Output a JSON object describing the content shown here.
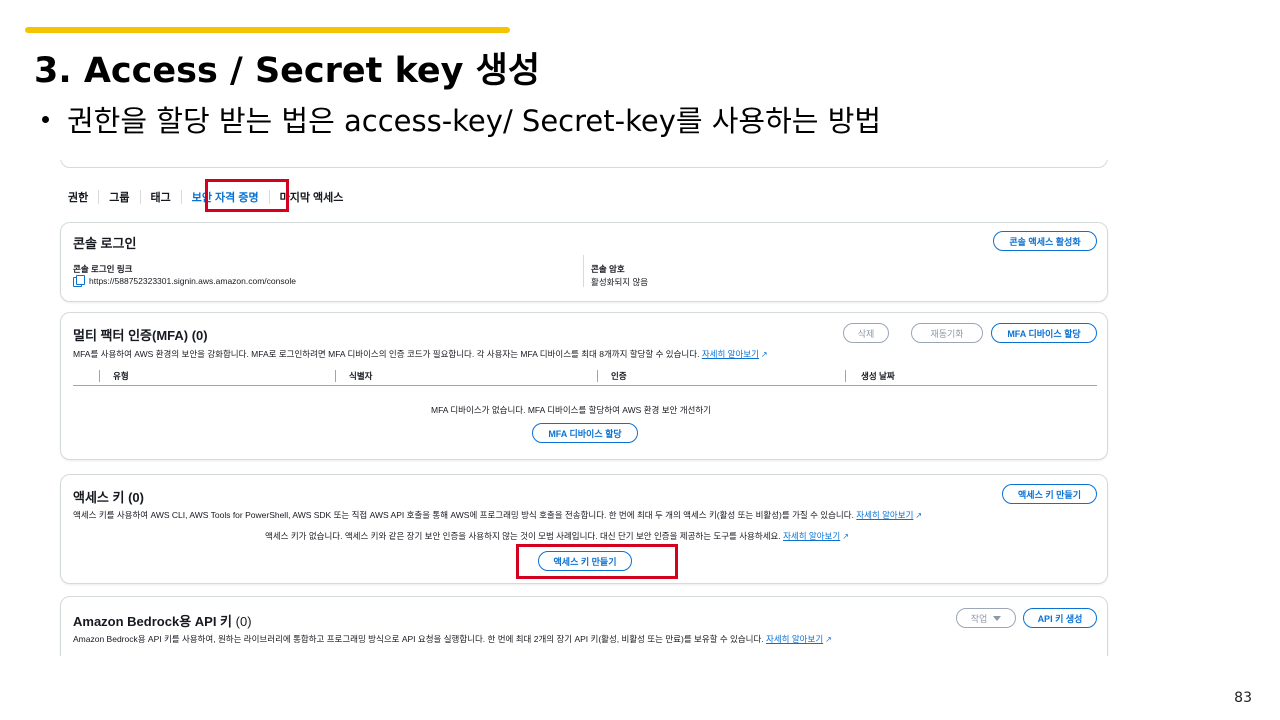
{
  "slide": {
    "title": "3. Access / Secret key 생성",
    "bullet": "권한을 할당 받는 법은 access-key/ Secret-key를 사용하는 방법",
    "page_number": "83"
  },
  "tabs": [
    "권한",
    "그룹",
    "태그",
    "보안 자격 증명",
    "마지막 액세스"
  ],
  "active_tab": "보안 자격 증명",
  "console_login": {
    "title": "콘솔 로그인",
    "enable_button": "콘솔 액세스 활성화",
    "link_label": "콘솔 로그인 링크",
    "link_value": "https://588752323301.signin.aws.amazon.com/console",
    "password_label": "콘솔 암호",
    "password_value": "활성화되지 않음"
  },
  "mfa": {
    "title": "멀티 팩터 인증(MFA)",
    "count": "(0)",
    "delete_button": "삭제",
    "resync_button": "재동기화",
    "assign_button": "MFA 디바이스 할당",
    "description": "MFA를 사용하여 AWS 환경의 보안을 강화합니다. MFA로 로그인하려면 MFA 디바이스의 인증 코드가 필요합니다. 각 사용자는 MFA 디바이스를 최대 8개까지 할당할 수 있습니다.",
    "learn_more": "자세히 알아보기",
    "columns": [
      "유형",
      "식별자",
      "인증",
      "생성 날짜"
    ],
    "empty_message": "MFA 디바이스가 없습니다. MFA 디바이스를 할당하여 AWS 환경 보안 개선하기",
    "empty_button": "MFA 디바이스 할당"
  },
  "access_keys": {
    "title": "액세스 키",
    "count": "(0)",
    "create_button": "액세스 키 만들기",
    "description": "액세스 키를 사용하여 AWS CLI, AWS Tools for PowerShell, AWS SDK 또는 직접 AWS API 호출을 통해 AWS에 프로그래밍 방식 호출을 전송합니다. 한 번에 최대 두 개의 액세스 키(활성 또는 비활성)를 가질 수 있습니다.",
    "learn_more": "자세히 알아보기",
    "empty_message": "액세스 키가 없습니다. 액세스 키와 같은 장기 보안 인증을 사용하지 않는 것이 모범 사례입니다. 대신 단기 보안 인증을 제공하는 도구를 사용하세요.",
    "empty_learn_more": "자세히 알아보기",
    "empty_button": "액세스 키 만들기"
  },
  "bedrock": {
    "title": "Amazon Bedrock용 API 키",
    "count": "(0)",
    "actions_button": "작업",
    "generate_button": "API 키 생성",
    "description": "Amazon Bedrock용 API 키를 사용하여, 원하는 라이브러리에 통합하고 프로그래밍 방식으로 API 요청을 실행합니다. 한 번에 최대 2개의 장기 API 키(활성, 비활성 또는 만료)를 보유할 수 있습니다.",
    "learn_more": "자세히 알아보기"
  },
  "colors": {
    "accent_bar": "#f5c400",
    "highlight_box": "#d4001f",
    "link_blue": "#0972d3"
  }
}
